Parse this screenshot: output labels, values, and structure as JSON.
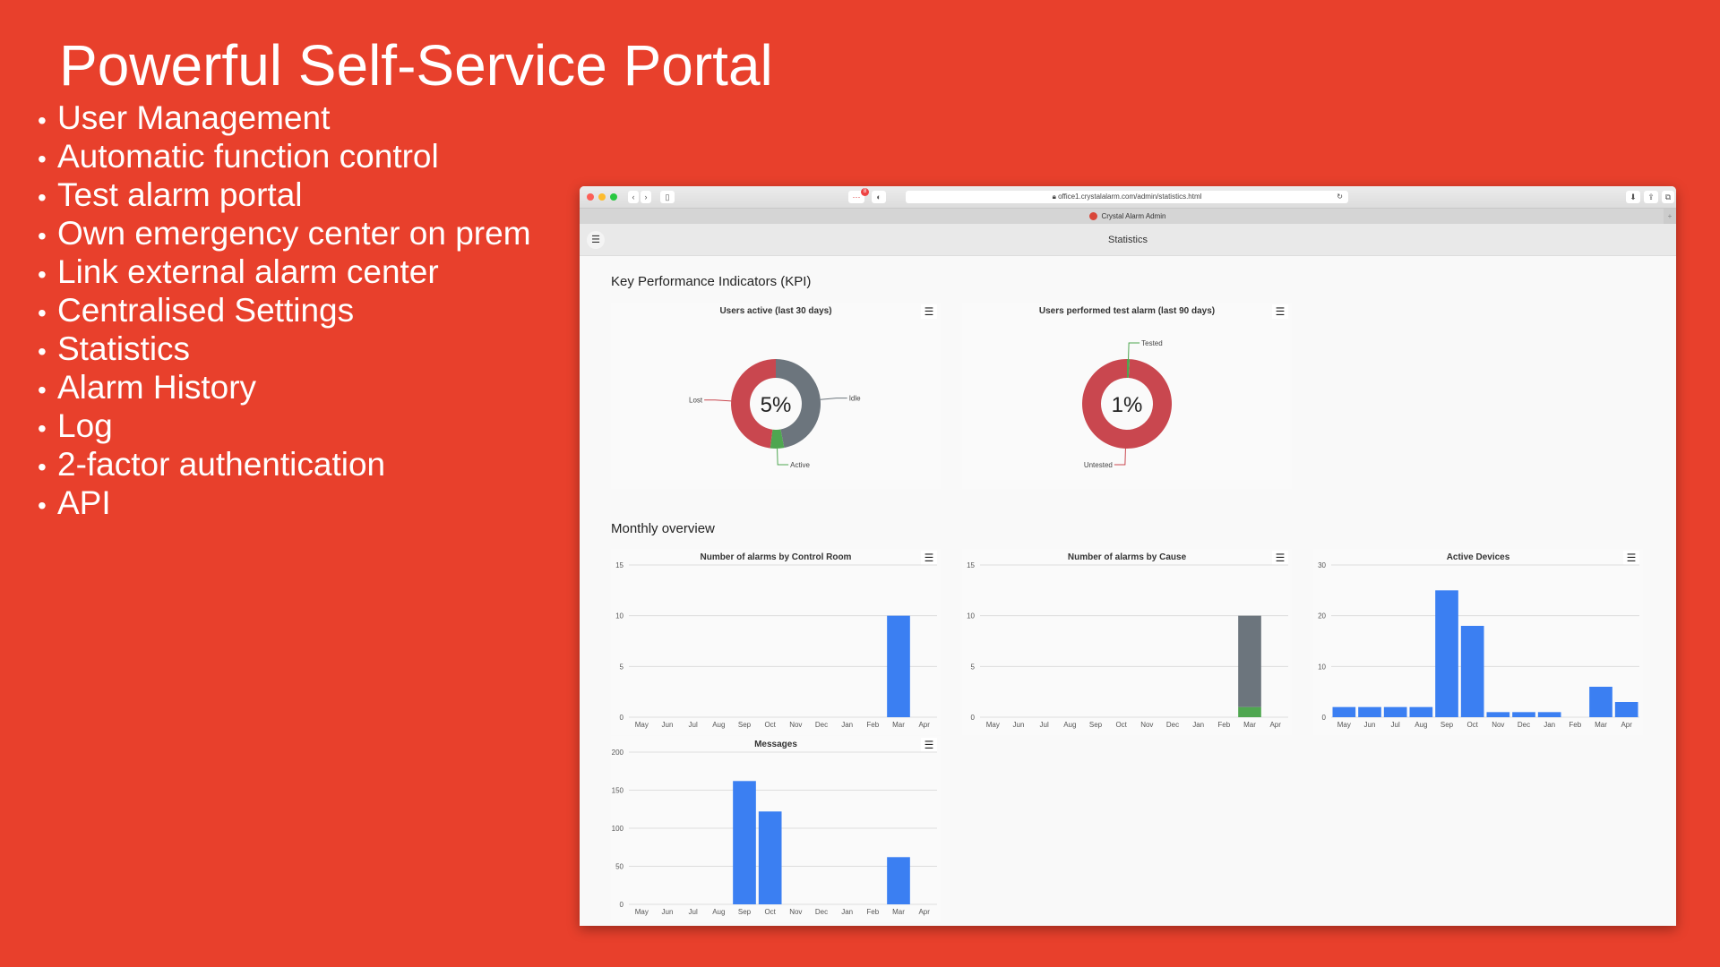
{
  "slide": {
    "title": "Powerful Self-Service Portal",
    "bullets": [
      "User Management",
      "Automatic function control",
      "Test alarm portal",
      "Own emergency center on prem",
      "Link external alarm center",
      "Centralised Settings",
      "Statistics",
      "Alarm History",
      "Log",
      "2-factor authentication",
      "API"
    ],
    "bullet_char": "•"
  },
  "browser": {
    "url": "office1.crystalalarm.com/admin/statistics.html",
    "tab_title": "Crystal Alarm Admin",
    "badge": "8",
    "page_header": "Statistics"
  },
  "colors": {
    "background": "#e8402c",
    "blue": "#3b7ff2",
    "red": "#c9474f",
    "grey": "#6c757d",
    "green": "#4fa650"
  },
  "sections": {
    "kpi": "Key Performance Indicators (KPI)",
    "monthly": "Monthly overview"
  },
  "kpi": [
    {
      "title": "Users active (last 30 days)",
      "center": "5%",
      "slices": [
        {
          "label": "Idle",
          "value": 47,
          "color": "#6c757d"
        },
        {
          "label": "Active",
          "value": 5,
          "color": "#4fa650"
        },
        {
          "label": "Lost",
          "value": 48,
          "color": "#c9474f"
        }
      ]
    },
    {
      "title": "Users performed test alarm (last 90 days)",
      "center": "1%",
      "slices": [
        {
          "label": "Tested",
          "value": 1,
          "color": "#4fa650"
        },
        {
          "label": "Untested",
          "value": 99,
          "color": "#c9474f"
        }
      ]
    }
  ],
  "chart_data": [
    {
      "type": "bar",
      "title": "Number of alarms by Control Room",
      "categories": [
        "May",
        "Jun",
        "Jul",
        "Aug",
        "Sep",
        "Oct",
        "Nov",
        "Dec",
        "Jan",
        "Feb",
        "Mar",
        "Apr"
      ],
      "series": [
        {
          "values": [
            0,
            0,
            0,
            0,
            0,
            0,
            0,
            0,
            0,
            0,
            10,
            0
          ],
          "color": "#3b7ff2"
        }
      ],
      "ylim": [
        0,
        15
      ],
      "yticks": [
        0,
        5,
        10,
        15
      ],
      "grid": true
    },
    {
      "type": "bar",
      "stacked": true,
      "title": "Number of alarms by Cause",
      "categories": [
        "May",
        "Jun",
        "Jul",
        "Aug",
        "Sep",
        "Oct",
        "Nov",
        "Dec",
        "Jan",
        "Feb",
        "Mar",
        "Apr"
      ],
      "series": [
        {
          "values": [
            0,
            0,
            0,
            0,
            0,
            0,
            0,
            0,
            0,
            0,
            1,
            0
          ],
          "color": "#4fa650"
        },
        {
          "values": [
            0,
            0,
            0,
            0,
            0,
            0,
            0,
            0,
            0,
            0,
            9,
            0
          ],
          "color": "#6c757d"
        }
      ],
      "ylim": [
        0,
        15
      ],
      "yticks": [
        0,
        5,
        10,
        15
      ],
      "grid": true
    },
    {
      "type": "bar",
      "title": "Active Devices",
      "categories": [
        "May",
        "Jun",
        "Jul",
        "Aug",
        "Sep",
        "Oct",
        "Nov",
        "Dec",
        "Jan",
        "Feb",
        "Mar",
        "Apr"
      ],
      "series": [
        {
          "values": [
            2,
            2,
            2,
            2,
            25,
            18,
            1,
            1,
            1,
            0,
            6,
            3
          ],
          "color": "#3b7ff2"
        }
      ],
      "ylim": [
        0,
        30
      ],
      "yticks": [
        0,
        10,
        20,
        30
      ],
      "grid": true
    },
    {
      "type": "bar",
      "title": "Messages",
      "categories": [
        "May",
        "Jun",
        "Jul",
        "Aug",
        "Sep",
        "Oct",
        "Nov",
        "Dec",
        "Jan",
        "Feb",
        "Mar",
        "Apr"
      ],
      "series": [
        {
          "values": [
            0,
            0,
            0,
            0,
            162,
            122,
            0,
            0,
            0,
            0,
            62,
            0
          ],
          "color": "#3b7ff2"
        }
      ],
      "ylim": [
        0,
        200
      ],
      "yticks": [
        0,
        50,
        100,
        150,
        200
      ],
      "grid": true
    }
  ]
}
